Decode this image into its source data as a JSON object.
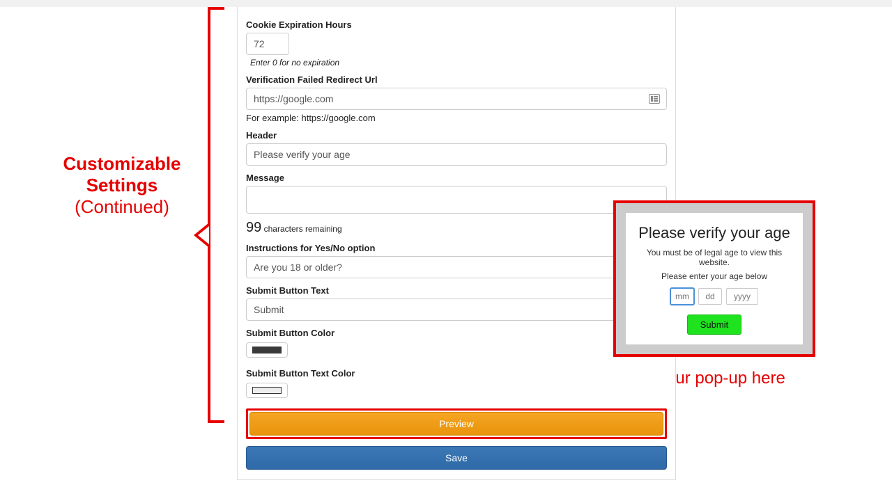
{
  "callouts": {
    "customizable_title": "Customizable",
    "customizable_sub": "Settings",
    "continued": "(Continued)",
    "preview_here": "Preview your pop-up here"
  },
  "form": {
    "cookie_label": "Cookie Expiration Hours",
    "cookie_value": "72",
    "cookie_help": "Enter 0 for no expiration",
    "redirect_label": "Verification Failed Redirect Url",
    "redirect_value": "https://google.com",
    "redirect_help": "For example: https://google.com",
    "header_label": "Header",
    "header_value": "Please verify your age",
    "message_label": "Message",
    "message_value": "",
    "chars_num": "99",
    "chars_text": "characters remaining",
    "yesno_label": "Instructions for Yes/No option",
    "yesno_value": "Are you 18 or older?",
    "submit_text_label": "Submit Button Text",
    "submit_text_value": "Submit",
    "submit_color_label": "Submit Button Color",
    "submit_color_value": "#3a3a3a",
    "submit_tcolor_label": "Submit Button Text Color",
    "submit_tcolor_value": "#ececec",
    "preview_btn": "Preview",
    "save_btn": "Save"
  },
  "popup": {
    "title": "Please verify your age",
    "message": "You must be of legal age to view this website.",
    "instruction": "Please enter your age below",
    "mm": "mm",
    "dd": "dd",
    "yyyy": "yyyy",
    "submit": "Submit"
  }
}
